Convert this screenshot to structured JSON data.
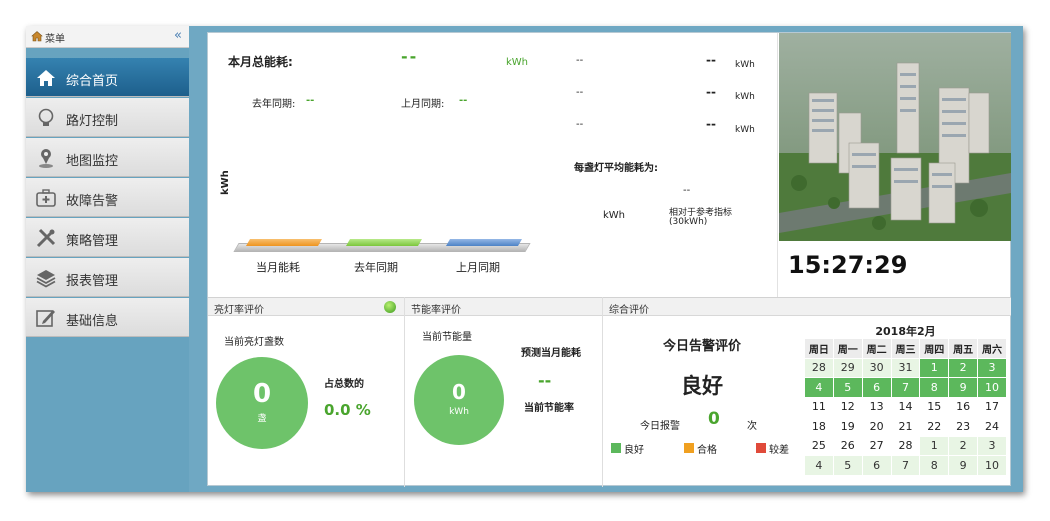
{
  "sidebar": {
    "title": "菜单",
    "collapse": "«",
    "items": [
      {
        "label": "综合首页",
        "icon": "home-icon"
      },
      {
        "label": "路灯控制",
        "icon": "bulb-icon"
      },
      {
        "label": "地图监控",
        "icon": "map-pin-icon"
      },
      {
        "label": "故障告警",
        "icon": "first-aid-icon"
      },
      {
        "label": "策略管理",
        "icon": "tools-icon"
      },
      {
        "label": "报表管理",
        "icon": "layers-icon"
      },
      {
        "label": "基础信息",
        "icon": "edit-icon"
      }
    ]
  },
  "energy": {
    "title": "本月总能耗:",
    "total_value": "--",
    "total_unit": "kWh",
    "last_year_label": "去年同期:",
    "last_year_value": "--",
    "last_month_label": "上月同期:",
    "last_month_value": "--",
    "axis_label": "kWh",
    "bars": [
      {
        "label": "当月能耗",
        "color": "#f2a23a"
      },
      {
        "label": "去年同期",
        "color": "#8ed050"
      },
      {
        "label": "上月同期",
        "color": "#5a8fd0"
      }
    ],
    "right_rows": [
      {
        "a": "--",
        "b": "--",
        "unit": "kWh"
      },
      {
        "a": "--",
        "b": "--",
        "unit": "kWh"
      },
      {
        "a": "--",
        "b": "--",
        "unit": "kWh"
      }
    ],
    "avg_label": "每盏灯平均能耗为:",
    "avg_value": "--",
    "avg_unit": "kWh",
    "compare_label": "相对于参考指标",
    "compare_ref": "(30kWh)"
  },
  "clock": "15:27:29",
  "light_rate": {
    "header": "亮灯率评价",
    "count_label": "当前亮灯盏数",
    "count_value": "0",
    "count_unit": "盏",
    "ratio_label": "占总数的",
    "ratio_value": "0.0 %"
  },
  "saving": {
    "header": "节能率评价",
    "amount_label": "当前节能量",
    "amount_value": "0",
    "amount_unit": "kWh",
    "forecast_label": "预测当月能耗",
    "forecast_value": "--",
    "rate_label": "当前节能率"
  },
  "overall": {
    "header": "综合评价",
    "title": "今日告警评价",
    "rating": "良好",
    "alarm_label": "今日报警",
    "alarm_count": "0",
    "alarm_unit": "次",
    "legend": [
      {
        "label": "良好",
        "color": "#5cb85c"
      },
      {
        "label": "合格",
        "color": "#f0a020"
      },
      {
        "label": "较差",
        "color": "#e04a3a"
      }
    ]
  },
  "calendar": {
    "title": "2018年2月",
    "weekdays": [
      "周日",
      "周一",
      "周二",
      "周三",
      "周四",
      "周五",
      "周六"
    ],
    "weeks": [
      [
        "28",
        "29",
        "30",
        "31",
        "1",
        "2",
        "3"
      ],
      [
        "4",
        "5",
        "6",
        "7",
        "8",
        "9",
        "10"
      ],
      [
        "11",
        "12",
        "13",
        "14",
        "15",
        "16",
        "17"
      ],
      [
        "18",
        "19",
        "20",
        "21",
        "22",
        "23",
        "24"
      ],
      [
        "25",
        "26",
        "27",
        "28",
        "1",
        "2",
        "3"
      ],
      [
        "4",
        "5",
        "6",
        "7",
        "8",
        "9",
        "10"
      ]
    ]
  }
}
